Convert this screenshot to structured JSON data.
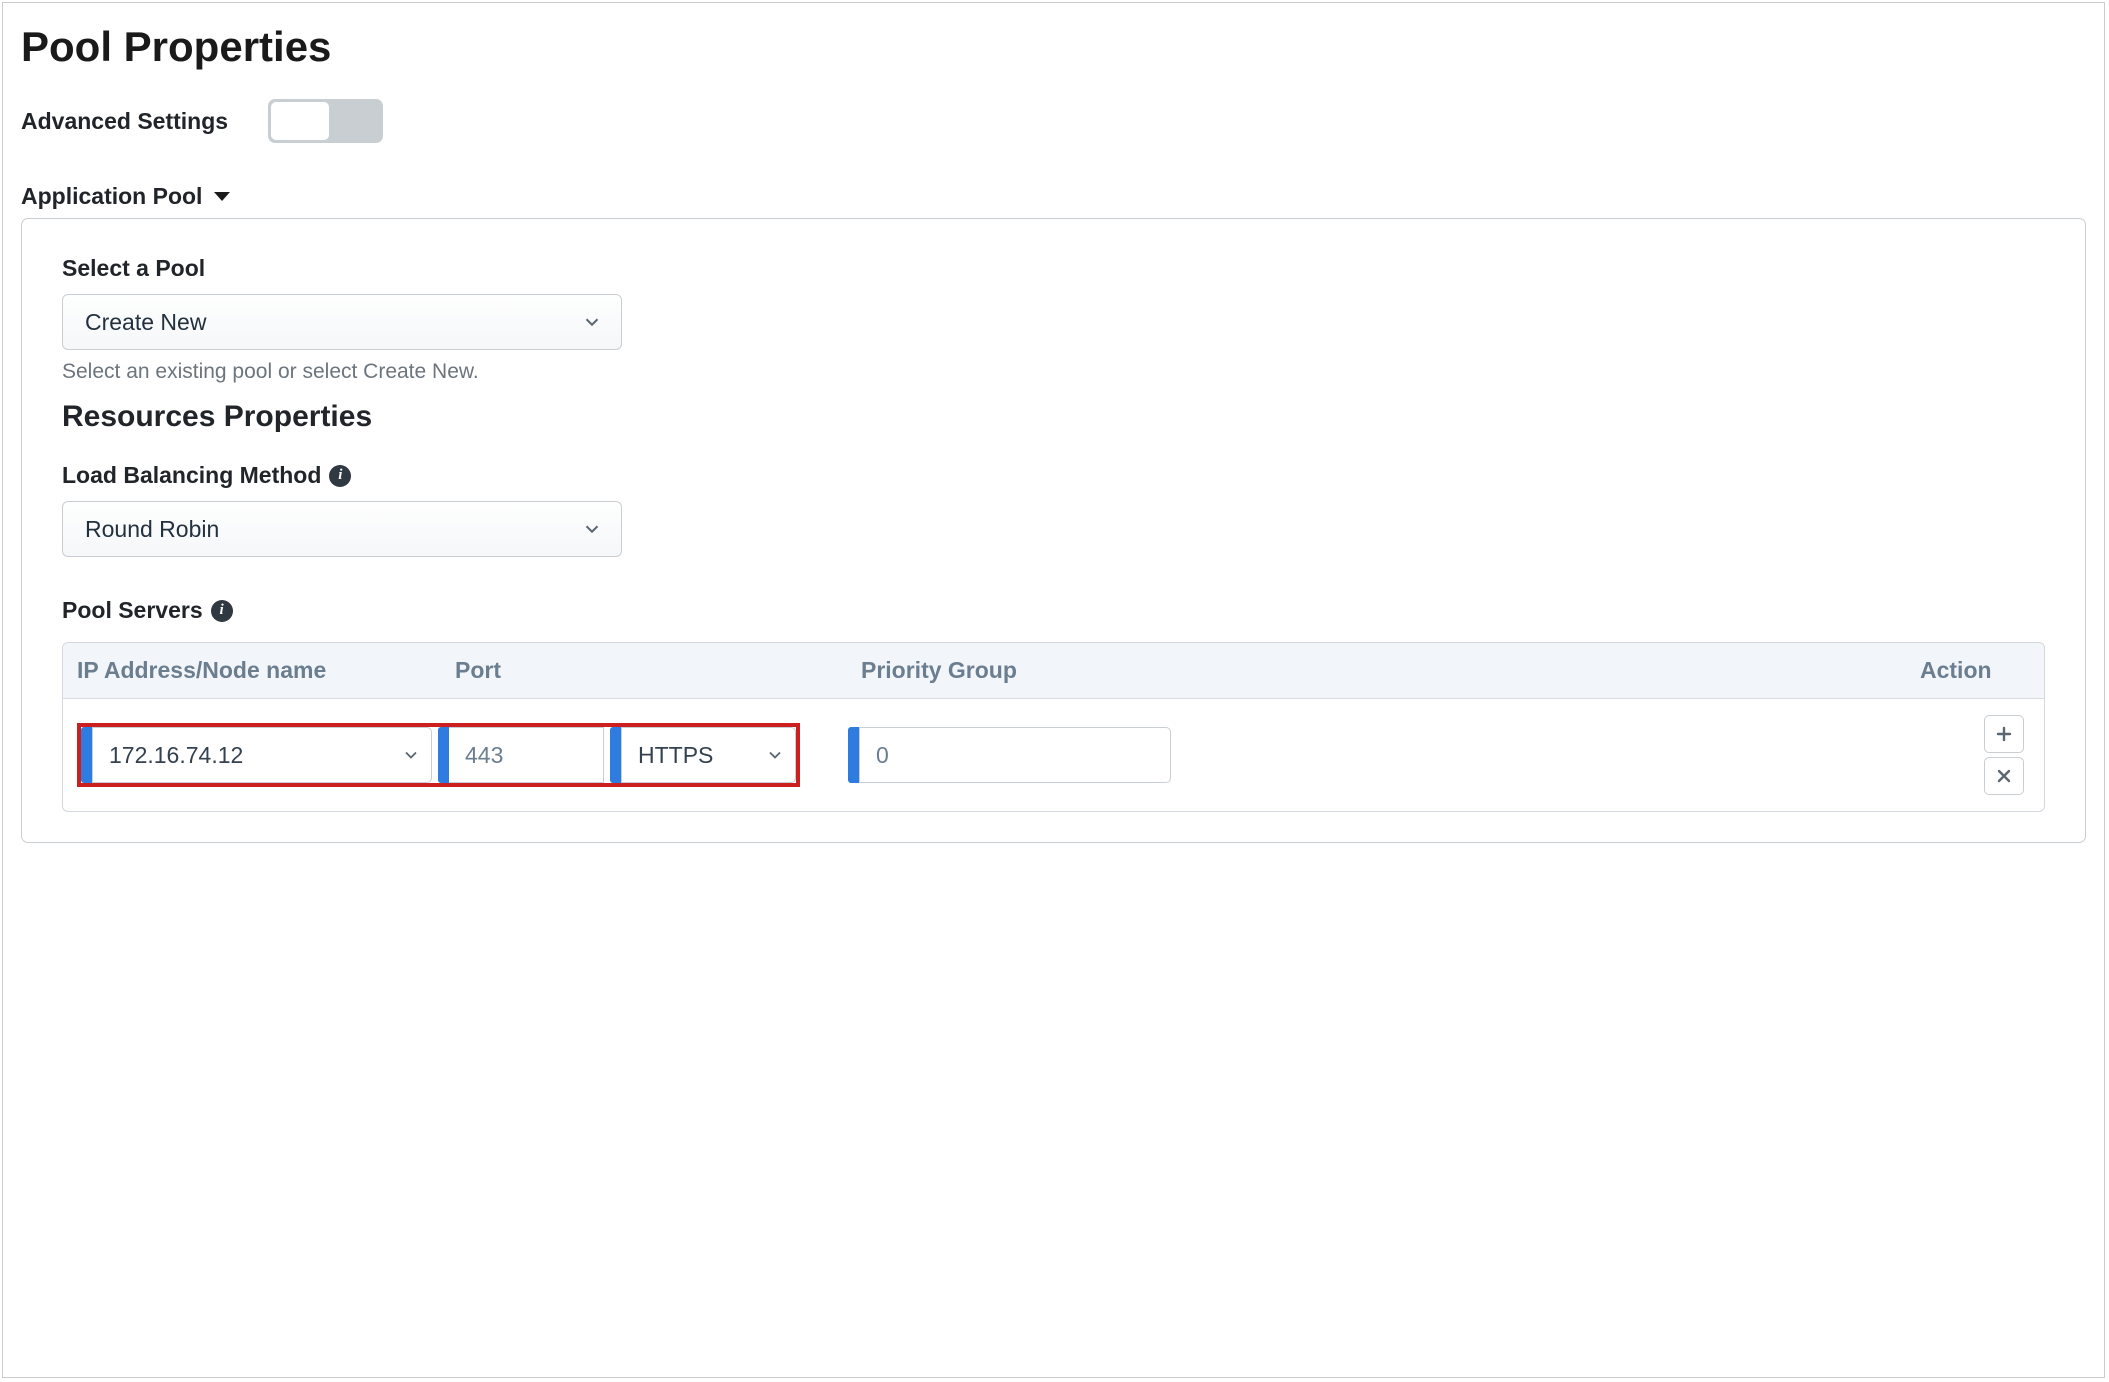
{
  "page": {
    "title": "Pool Properties",
    "advanced_settings_label": "Advanced Settings",
    "advanced_settings_on": false
  },
  "section": {
    "title": "Application Pool"
  },
  "pool": {
    "select_label": "Select a Pool",
    "select_value": "Create New",
    "select_helper": "Select an existing pool or select Create New."
  },
  "resources": {
    "title": "Resources Properties",
    "lb_label": "Load Balancing Method",
    "lb_value": "Round Robin",
    "servers_label": "Pool Servers",
    "columns": {
      "ip": "IP Address/Node name",
      "port": "Port",
      "priority": "Priority Group",
      "action": "Action"
    },
    "row": {
      "ip": "172.16.74.12",
      "port": "443",
      "protocol": "HTTPS",
      "priority": "0"
    }
  }
}
